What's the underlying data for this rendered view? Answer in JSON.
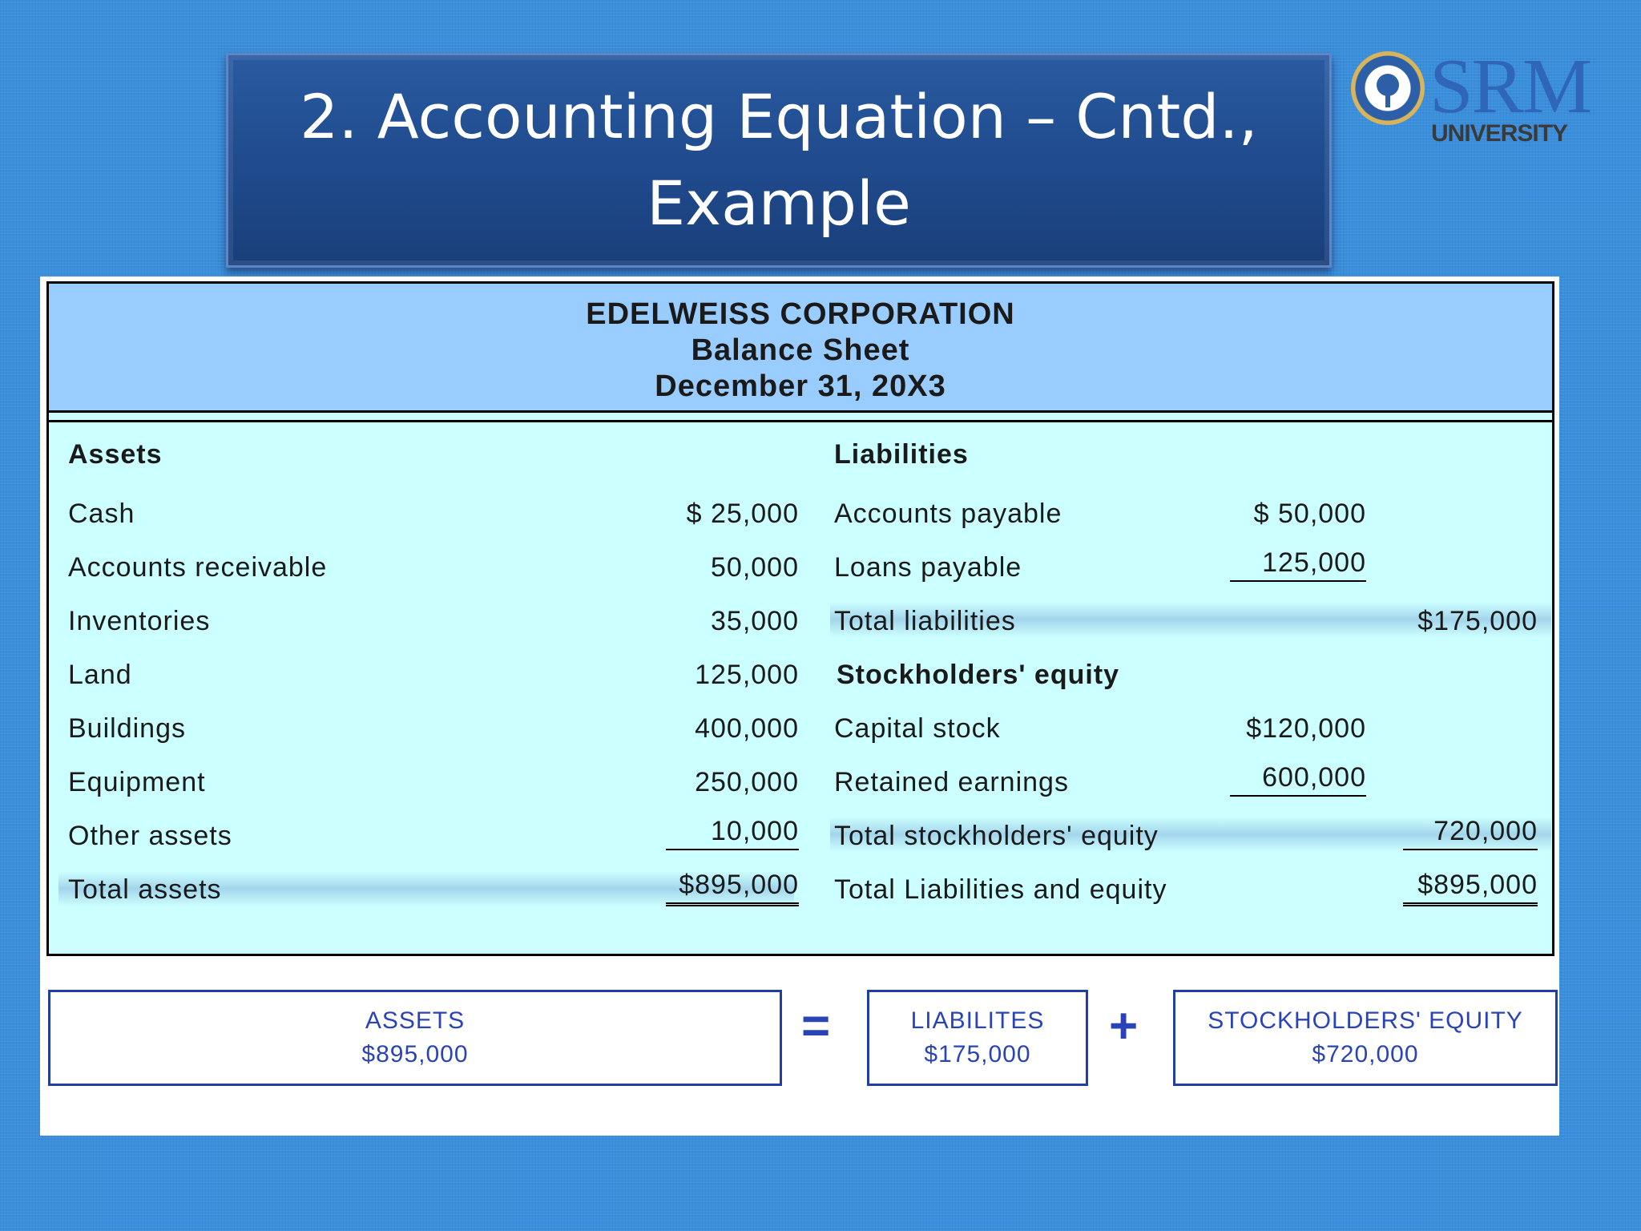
{
  "title": {
    "line1": "2. Accounting Equation – Cntd.,",
    "line2": "Example"
  },
  "logo": {
    "name": "SRM",
    "sub": "UNIVERSITY",
    "seal_icon": "university-seal-icon"
  },
  "sheet": {
    "company": "EDELWEISS CORPORATION",
    "statement": "Balance Sheet",
    "date": "December 31, 20X3",
    "assets": {
      "heading": "Assets",
      "rows": [
        {
          "label": "Cash",
          "amount": "$  25,000"
        },
        {
          "label": "Accounts receivable",
          "amount": "50,000"
        },
        {
          "label": "Inventories",
          "amount": "35,000"
        },
        {
          "label": "Land",
          "amount": "125,000"
        },
        {
          "label": "Buildings",
          "amount": "400,000"
        },
        {
          "label": "Equipment",
          "amount": "250,000"
        },
        {
          "label": "Other assets",
          "amount": "10,000"
        }
      ],
      "total_label": "Total assets",
      "total_amount": "$895,000"
    },
    "liabilities": {
      "heading": "Liabilities",
      "rows": [
        {
          "label": "Accounts payable",
          "amount": "$  50,000"
        },
        {
          "label": "Loans payable",
          "amount": "125,000"
        }
      ],
      "total_label": "Total liabilities",
      "total_amount": "$175,000"
    },
    "equity": {
      "heading": "Stockholders' equity",
      "rows": [
        {
          "label": "Capital stock",
          "amount": "$120,000"
        },
        {
          "label": "Retained earnings",
          "amount": "600,000"
        }
      ],
      "total_label": "Total stockholders' equity",
      "total_amount": "720,000"
    },
    "grand_total_label": "Total Liabilities and equity",
    "grand_total_amount": "$895,000"
  },
  "equation": {
    "assets_label": "ASSETS",
    "assets_value": "$895,000",
    "equals": "=",
    "liabilities_label": "LIABILITES",
    "liabilities_value": "$175,000",
    "plus": "+",
    "equity_label": "STOCKHOLDERS' EQUITY",
    "equity_value": "$720,000"
  }
}
